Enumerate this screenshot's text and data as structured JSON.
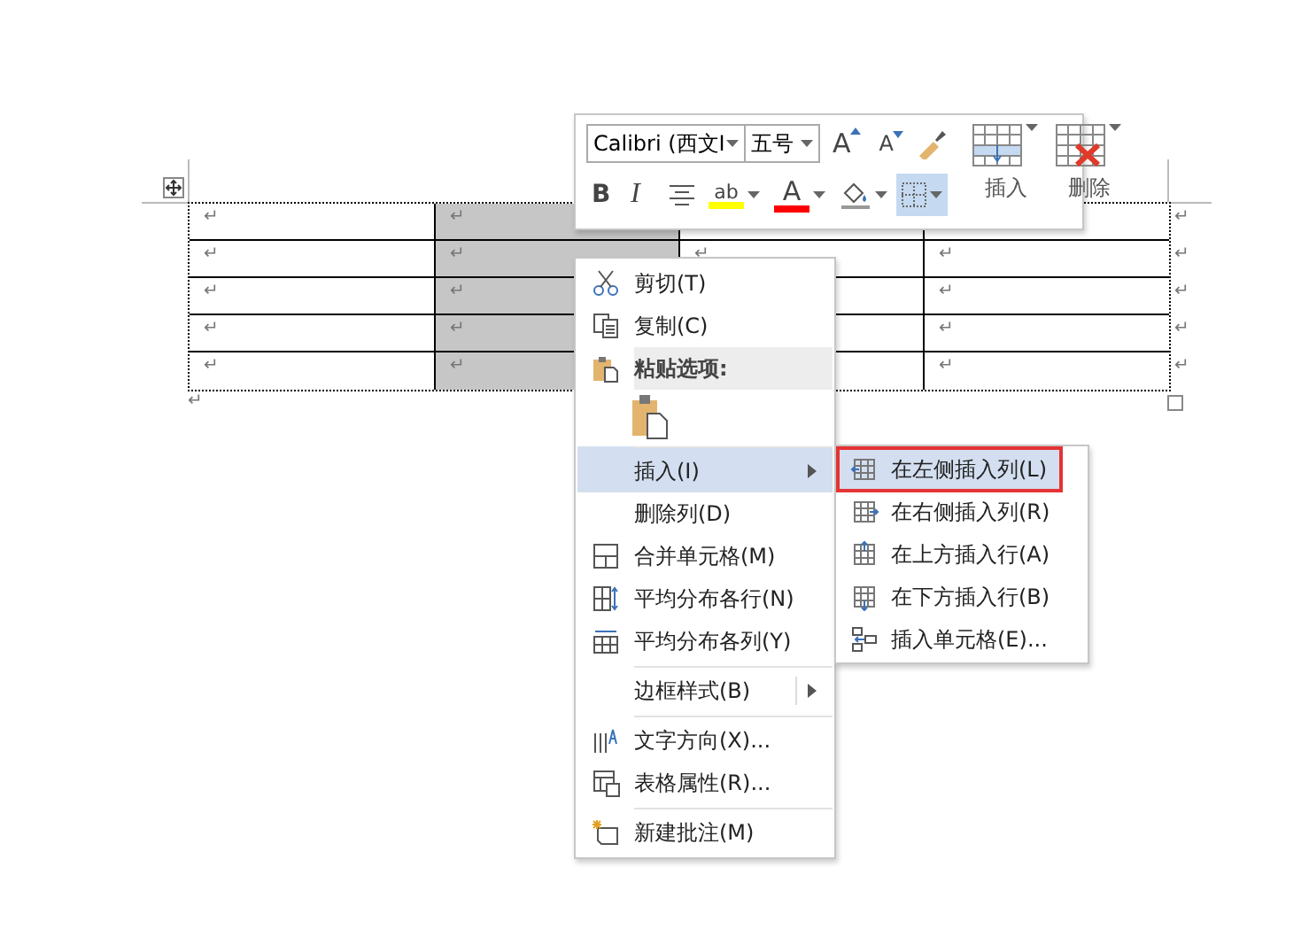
{
  "document": {
    "table": {
      "rows": [
        [
          {
            "text": "↵",
            "selected": false
          },
          {
            "text": "↵",
            "selected": true
          },
          {
            "selected": false
          },
          {
            "selected": false
          }
        ],
        [
          {
            "text": "↵",
            "selected": false
          },
          {
            "text": "↵",
            "selected": true
          },
          {
            "text": "↵",
            "selected": false
          },
          {
            "text": "↵",
            "selected": false
          }
        ],
        [
          {
            "text": "↵",
            "selected": false
          },
          {
            "text": "↵",
            "selected": true
          },
          {
            "selected": false
          },
          {
            "text": "↵",
            "selected": false
          }
        ],
        [
          {
            "text": "↵",
            "selected": false
          },
          {
            "text": "↵",
            "selected": true
          },
          {
            "selected": false
          },
          {
            "text": "↵",
            "selected": false
          }
        ],
        [
          {
            "text": "↵",
            "selected": false
          },
          {
            "text": "↵",
            "selected": true
          },
          {
            "selected": false
          },
          {
            "text": "↵",
            "selected": false
          }
        ]
      ],
      "row_end_marks": [
        "↵",
        "↵",
        "↵",
        "↵",
        "↵"
      ]
    },
    "after_mark": "↵"
  },
  "mini_toolbar": {
    "font": "Calibri (西文I",
    "size": "五号",
    "grow_font": "A",
    "shrink_font": "A",
    "insert_label": "插入",
    "delete_label": "删除",
    "buttons": [
      {
        "kind": "bold",
        "label": "B",
        "selected": false
      },
      {
        "kind": "italic",
        "label": "I",
        "selected": false
      },
      {
        "kind": "align",
        "selected": false
      },
      {
        "kind": "highlight",
        "label": "ab",
        "color": "#ffff00",
        "selected": false
      },
      {
        "kind": "fontcolor",
        "label": "A",
        "color": "#ff0000",
        "selected": false
      },
      {
        "kind": "shading",
        "selected": false
      },
      {
        "kind": "borders",
        "selected": true
      }
    ]
  },
  "context_menu": {
    "items": [
      {
        "kind": "command",
        "label": "剪切(T)",
        "selected": false,
        "separator_before": false
      },
      {
        "kind": "command",
        "label": "复制(C)",
        "selected": false,
        "separator_before": false
      },
      {
        "kind": "header",
        "label": "粘贴选项:",
        "separator_before": false
      },
      {
        "kind": "paste",
        "separator_before": false
      },
      {
        "kind": "submenu",
        "label": "插入(I)",
        "selected": true,
        "separator_before": true
      },
      {
        "kind": "command",
        "label": "删除列(D)",
        "selected": false,
        "separator_before": false
      },
      {
        "kind": "command",
        "label": "合并单元格(M)",
        "selected": false,
        "separator_before": false
      },
      {
        "kind": "command",
        "label": "平均分布各行(N)",
        "selected": false,
        "separator_before": false
      },
      {
        "kind": "command",
        "label": "平均分布各列(Y)",
        "selected": false,
        "separator_before": false
      },
      {
        "kind": "submenu",
        "label": "边框样式(B)",
        "selected": false,
        "separator_before": true
      },
      {
        "kind": "command",
        "label": "文字方向(X)...",
        "selected": false,
        "separator_before": true
      },
      {
        "kind": "command",
        "label": "表格属性(R)...",
        "selected": false,
        "separator_before": false
      },
      {
        "kind": "command",
        "label": "新建批注(M)",
        "selected": false,
        "separator_before": true
      }
    ]
  },
  "submenu": {
    "items": [
      {
        "label": "在左侧插入列(L)",
        "selected": true
      },
      {
        "label": "在右侧插入列(R)",
        "selected": false
      },
      {
        "label": "在上方插入行(A)",
        "selected": false
      },
      {
        "label": "在下方插入行(B)",
        "selected": false
      },
      {
        "label": "插入单元格(E)...",
        "selected": false
      }
    ]
  }
}
